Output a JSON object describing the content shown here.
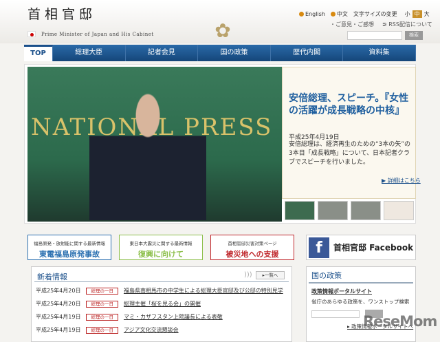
{
  "header": {
    "title": "首相官邸",
    "subtitle": "Prime Minister of Japan and His Cabinet",
    "english": "English",
    "chinese": "中文",
    "font_size_label": "文字サイズの変更",
    "sizes": [
      "小",
      "中",
      "大"
    ],
    "feedback": "・ご意見・ご感想",
    "rss": "RSS配信について",
    "search_button": "検索",
    "search_value": ""
  },
  "nav": [
    "TOP",
    "総理大臣",
    "記者会見",
    "国の政策",
    "歴代内閣",
    "資料集"
  ],
  "hero": {
    "photo_text": "NATIONAL PRESS",
    "title": "安倍総理、スピーチ。『女性の活躍が成長戦略の中核』",
    "date": "平成25年4月19日",
    "body": "安倍総理は、経済再生のための“3本の矢”の3本目「成長戦略」について、日本記者クラブでスピーチを行いました。",
    "more": "▶ 詳細はこちら"
  },
  "banners": [
    {
      "small": "福島原発・放射能に関する最新情報",
      "big": "東電福島原発事故",
      "color": "#2a6fb0"
    },
    {
      "small": "東日本大震災に関する最新情報",
      "big": "復興に向けて",
      "color": "#8cbf4a"
    },
    {
      "small": "首相官邸災害対策ページ",
      "big": "被災地への支援",
      "color": "#c0282d"
    }
  ],
  "facebook": {
    "label": "首相官邸 Facebook",
    "icon": "f"
  },
  "news": {
    "title": "新着情報",
    "list_button": "▸一覧へ",
    "items": [
      {
        "date": "平成25年4月20日",
        "tag": "総理の一日",
        "text": "福島県南相馬市の中学生による総理大臣官邸及び公邸の特別見学"
      },
      {
        "date": "平成25年4月20日",
        "tag": "総理の一日",
        "text": "総理主催「桜を見る会」の開催"
      },
      {
        "date": "平成25年4月19日",
        "tag": "総理の一日",
        "text": "マミ・カザフスタン上院議長による表敬"
      },
      {
        "date": "平成25年4月19日",
        "tag": "総理の一日",
        "text": "アジア文化交流懇談会"
      }
    ]
  },
  "policy": {
    "title": "国の政策",
    "link": "政策情報ポータルサイト",
    "desc": "省庁のあらゆる政策を、ワンストップ検索",
    "more": "▸ 政策情報ポータルサイトへ"
  },
  "watermark": "ReseMom"
}
